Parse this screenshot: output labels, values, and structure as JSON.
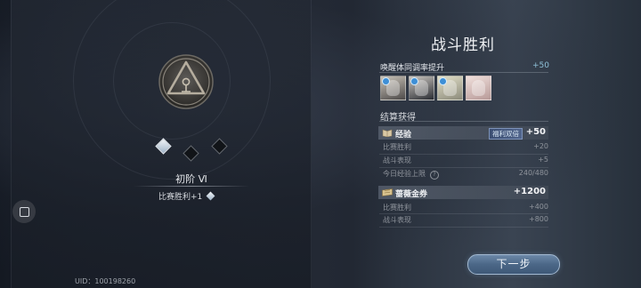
{
  "left": {
    "rank_name": "初阶 Ⅵ",
    "rank_bonus": "比赛胜利+1",
    "uid": "UID：100198260",
    "progress": {
      "filled": 1,
      "total": 3
    }
  },
  "result": {
    "title": "战斗胜利",
    "wake_label": "唤醒体同调率提升",
    "wake_value": "+50",
    "avatars": [
      "character-avatar-1",
      "character-avatar-2",
      "character-avatar-3",
      "character-avatar-4"
    ],
    "settlement_label": "结算获得",
    "exp": {
      "name": "经验",
      "tag": "福利双倍",
      "value": "+50",
      "rows": [
        {
          "label": "比赛胜利",
          "value": "+20"
        },
        {
          "label": "战斗表现",
          "value": "+5"
        },
        {
          "label": "今日经验上限",
          "value": "240/480",
          "help": "?"
        }
      ]
    },
    "coupon": {
      "name": "蔷薇金券",
      "value": "+1200",
      "rows": [
        {
          "label": "比赛胜利",
          "value": "+400"
        },
        {
          "label": "战斗表现",
          "value": "+800"
        }
      ]
    }
  },
  "next_button": "下一步",
  "colors": {
    "accent": "#8fc1d9",
    "button": "#4b6787",
    "tag": "#3c4f73"
  }
}
